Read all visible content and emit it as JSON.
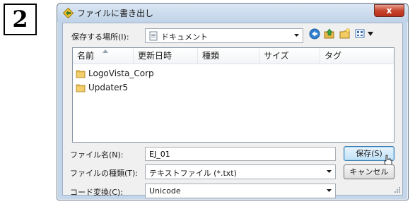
{
  "step": {
    "number": "2"
  },
  "dialog": {
    "title": "ファイルに書き出し",
    "close_label": "x"
  },
  "location": {
    "label": "保存する場所(I):",
    "value": "ドキュメント"
  },
  "columns": [
    "名前",
    "更新日時",
    "種類",
    "サイズ",
    "タグ"
  ],
  "files": [
    {
      "name": "LogoVista_Corp",
      "icon": "folder-icon"
    },
    {
      "name": "Updater5",
      "icon": "folder-icon"
    }
  ],
  "filename": {
    "label": "ファイル名(N):",
    "value": "EJ_01"
  },
  "filetype": {
    "label": "ファイルの種類(T):",
    "value": "テキストファイル (*.txt)"
  },
  "encoding": {
    "label": "コード変換(C):",
    "value": "Unicode"
  },
  "buttons": {
    "save": "保存(S)",
    "cancel": "キャンセル"
  },
  "colors": {
    "title_bg": "#c4d6ea",
    "close_red": "#c7442d",
    "default_button": "#bfe1f7",
    "folder": "#e8b84a"
  }
}
